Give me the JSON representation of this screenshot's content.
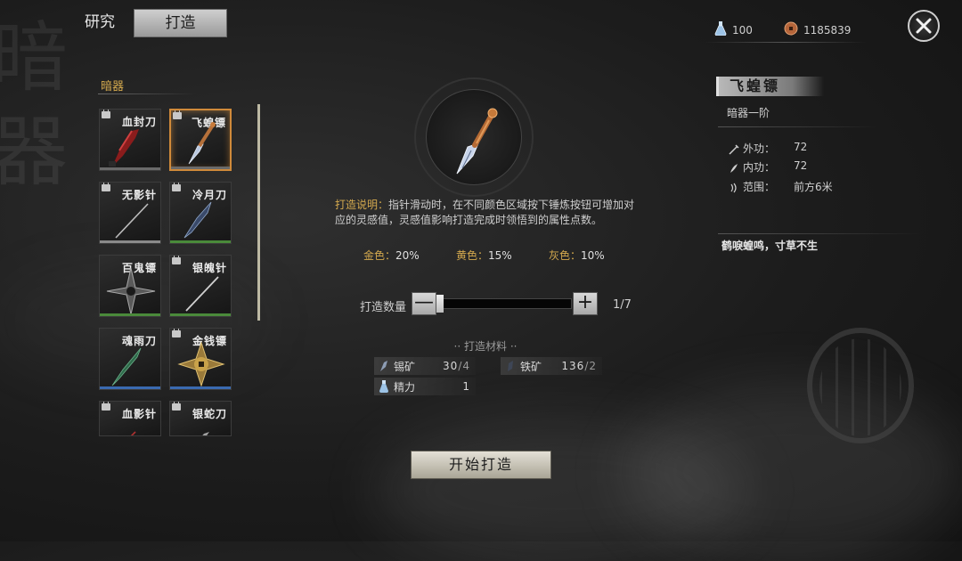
{
  "tabs": {
    "research": "研究",
    "forge": "打造"
  },
  "resources": {
    "potion": "100",
    "coin": "1185839"
  },
  "bg_chars": [
    "暗",
    "器"
  ],
  "category": "暗器",
  "weapons": [
    {
      "name": "血封刀",
      "quality_color": "#6a6a6a"
    },
    {
      "name": "飞蝗镖",
      "quality_color": "#6a6a6a"
    },
    {
      "name": "无影针",
      "quality_color": "#8a8a8a"
    },
    {
      "name": "冷月刀",
      "quality_color": "#4a8a3a"
    },
    {
      "name": "百鬼镖",
      "quality_color": "#4a8a3a"
    },
    {
      "name": "银魄针",
      "quality_color": "#4a8a3a"
    },
    {
      "name": "魂雨刀",
      "quality_color": "#3a6ab0"
    },
    {
      "name": "金钱镖",
      "quality_color": "#3a6ab0"
    },
    {
      "name": "血影针",
      "quality_color": "#6a6a6a"
    },
    {
      "name": "银蛇刀",
      "quality_color": "#6a6a6a"
    }
  ],
  "forge": {
    "desc_label": "打造说明：",
    "desc_text": "指针滑动时，在不同颜色区域按下锤炼按钮可增加对应的灵感值，灵感值影响打造完成时领悟到的属性点数。",
    "gold_label": "金色：",
    "gold": "20%",
    "yellow_label": "黄色：",
    "yellow": "15%",
    "gray_label": "灰色：",
    "gray": "10%",
    "qty_label": "打造数量",
    "minus": "—",
    "plus": "+",
    "qty": "1/7",
    "materials_title": "打造材料",
    "materials": [
      {
        "name": "锡矿",
        "have": "30",
        "need": "/4"
      },
      {
        "name": "铁矿",
        "have": "136",
        "need": "/2"
      },
      {
        "name": "精力",
        "have": "1",
        "need": ""
      }
    ],
    "start": "开始打造"
  },
  "detail": {
    "name": "飞蝗镖",
    "tier": "暗器一阶",
    "stats": [
      {
        "label": "外功：",
        "value": "72"
      },
      {
        "label": "内功：",
        "value": "72"
      },
      {
        "label": "范围：",
        "value": "前方6米"
      }
    ],
    "motto": "鹤唳蝗鸣，寸草不生"
  }
}
